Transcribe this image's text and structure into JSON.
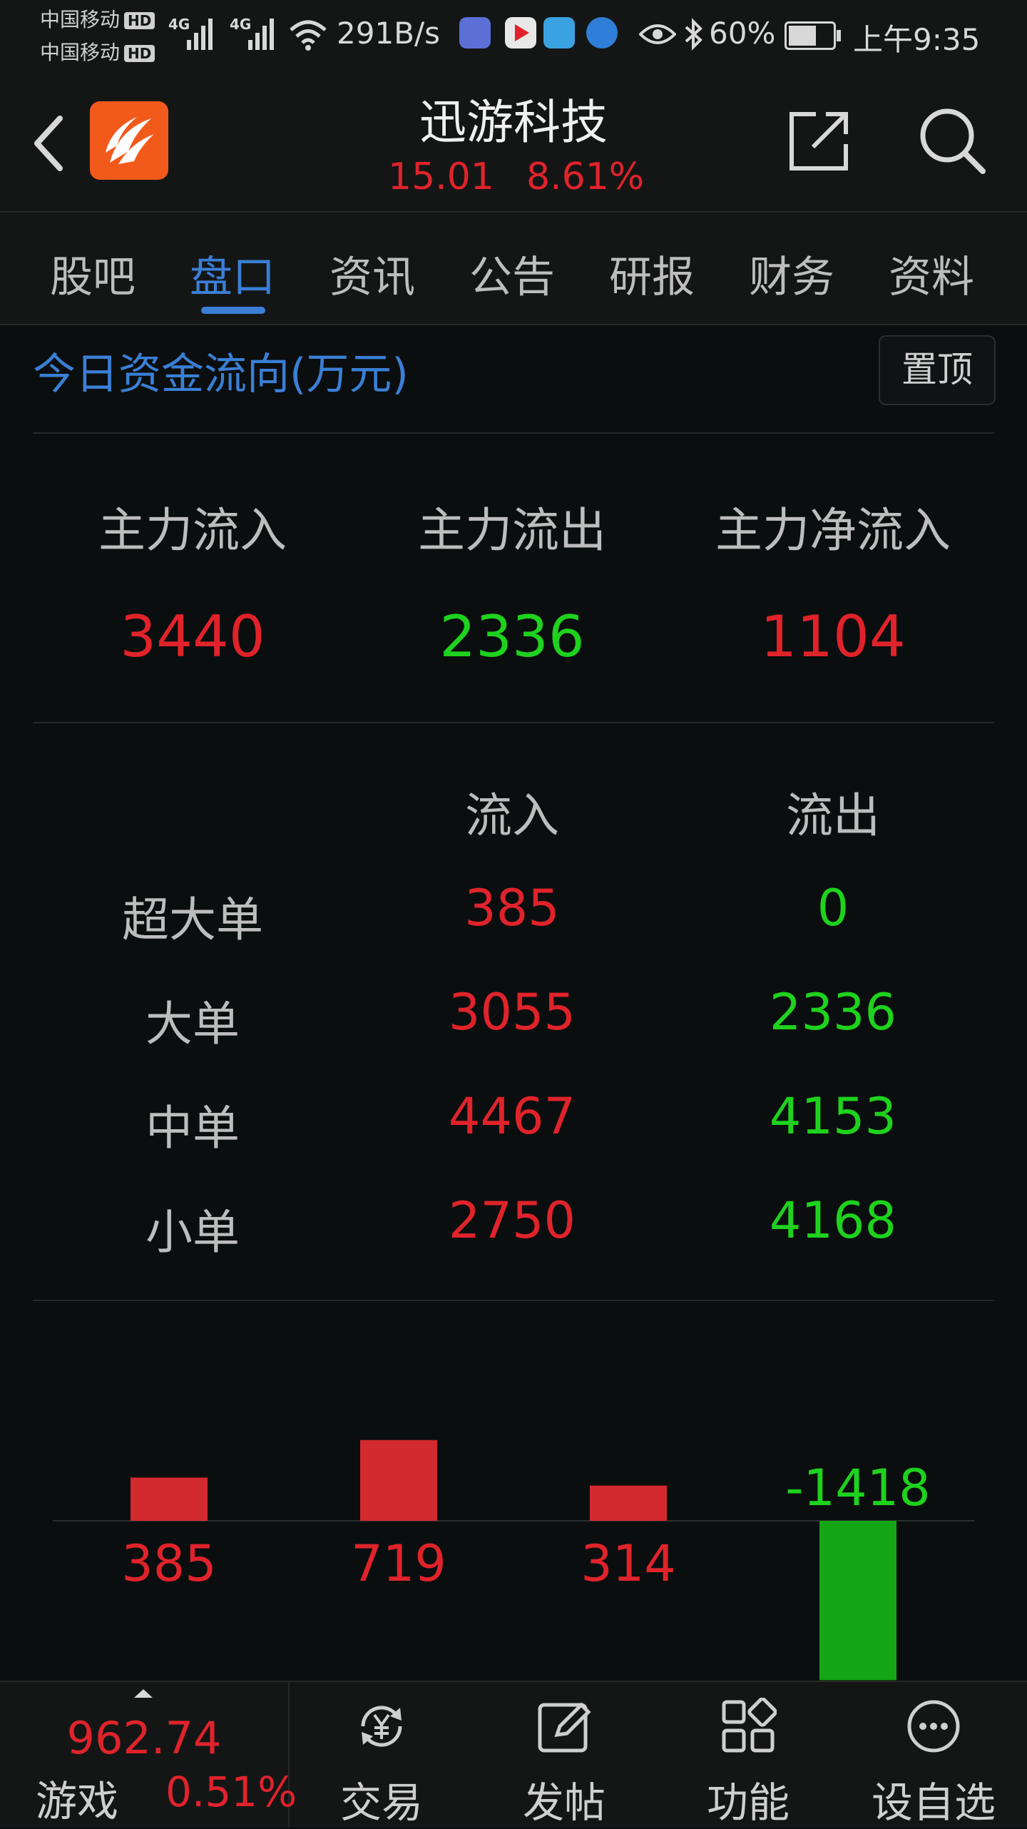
{
  "status_bar": {
    "carrier1": "中国移动",
    "carrier2": "中国移动",
    "hd": "HD",
    "net": "4G",
    "speed": "291B/s",
    "battery": "60%",
    "time": "上午9:35"
  },
  "header": {
    "title": "迅游科技",
    "price": "15.01",
    "change_pct": "8.61%"
  },
  "tabs": [
    {
      "label": "股吧"
    },
    {
      "label": "盘口"
    },
    {
      "label": "资讯"
    },
    {
      "label": "公告"
    },
    {
      "label": "研报"
    },
    {
      "label": "财务"
    },
    {
      "label": "资料"
    }
  ],
  "active_tab": "盘口",
  "section": {
    "title": "今日资金流向(万元)",
    "pin_label": "置顶"
  },
  "summary": {
    "main_in_label": "主力流入",
    "main_out_label": "主力流出",
    "main_net_label": "主力净流入",
    "main_in": "3440",
    "main_out": "2336",
    "main_net": "1104"
  },
  "table": {
    "col_in": "流入",
    "col_out": "流出",
    "rows": [
      {
        "label": "超大单",
        "in": "385",
        "out": "0"
      },
      {
        "label": "大单",
        "in": "3055",
        "out": "2336"
      },
      {
        "label": "中单",
        "in": "4467",
        "out": "4153"
      },
      {
        "label": "小单",
        "in": "2750",
        "out": "4168"
      }
    ]
  },
  "chart_data": {
    "type": "bar",
    "values": [
      385,
      719,
      314,
      -1418
    ],
    "data_labels": [
      "385",
      "719",
      "314",
      "-1418"
    ],
    "colors": {
      "positive": "#d32a2f",
      "negative": "#14a614"
    }
  },
  "bottom": {
    "index_value": "962.74",
    "index_name": "游戏",
    "index_pct": "0.51%",
    "nav": [
      {
        "label": "交易",
        "icon": "yuan-exchange-icon"
      },
      {
        "label": "发帖",
        "icon": "edit-post-icon"
      },
      {
        "label": "功能",
        "icon": "apps-grid-icon"
      },
      {
        "label": "设自选",
        "icon": "more-dots-icon"
      }
    ]
  },
  "colors": {
    "up": "#e0232b",
    "down": "#1ed21e",
    "accent": "#3a7fd5",
    "background": "#0b0e0e"
  }
}
